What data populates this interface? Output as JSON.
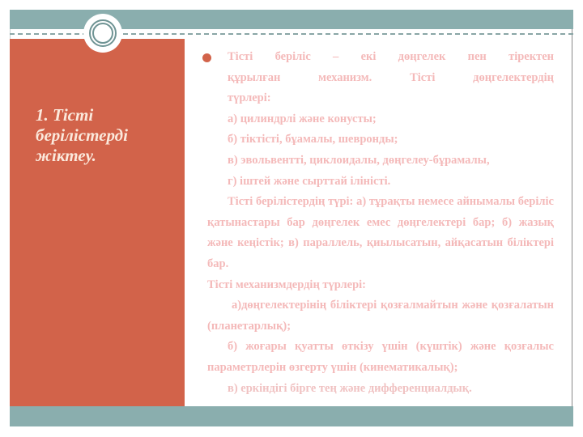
{
  "slide": {
    "title": "1. Тісті берілістерді жіктеу.",
    "colors": {
      "accent_orange": "#d2634a",
      "band_teal": "#8aaeae",
      "title_text": "#fbe9dc",
      "body_text": "#f4b9b9"
    },
    "bullet": {
      "lines": [
        "Тісті беріліс – екі дөңгелек пен тіректен",
        "құрылған механизм. Тісті дөңгелектердің",
        "түрлері:"
      ]
    },
    "gear_types": [
      "а) цилиндрлі және конусты;",
      "б) тіктісті, бұамалы, шевронды;",
      "в) эвольвентті, циклоидалы, дөңгелеу-бұрамалы,",
      "г) іштей және сырттай іліністі."
    ],
    "paragraph_transmission": "Тісті берілістердің түрі: а) тұрақты немесе айнымалы беріліс қатынастары бар дөңгелек емес дөңгелектері бар; б) жазық және кеңістік; в) параллель, қиылысатын, айқасатын біліктері бар.",
    "mechanisms_heading": "Тісті механизмдердің түрлері:",
    "mechanism_a": "а)дөңгелектерінің біліктері қозғалмайтын және қозғалатын (планетарлық);",
    "mechanism_b": "б) жоғары қуатты өткізу үшін (күштік) және қозғалыс параметрлерін өзгерту үшін (кинематикалық);",
    "mechanism_c": "в) еркіндігі бірге тең және дифференциалдық."
  }
}
